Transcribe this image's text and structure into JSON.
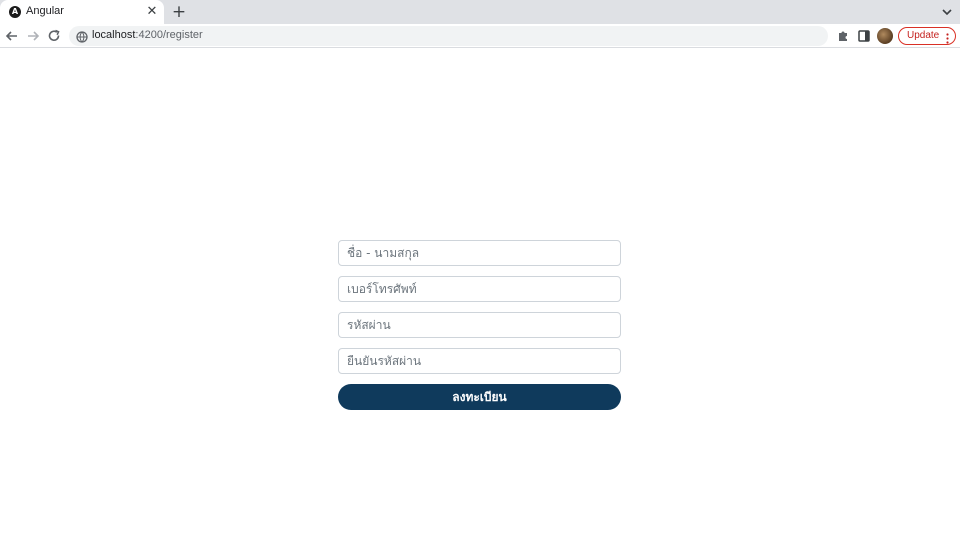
{
  "browser": {
    "tab": {
      "title": "Angular",
      "favicon": "angular-logo-icon",
      "close_glyph": "✕"
    },
    "new_tab_glyph": "+",
    "url": {
      "host": "localhost",
      "path": ":4200/register"
    },
    "update_label": "Update"
  },
  "form": {
    "fullname_placeholder": "ชื่อ - นามสกุล",
    "phone_placeholder": "เบอร์โทรศัพท์",
    "password_placeholder": "รหัสผ่าน",
    "confirm_password_placeholder": "ยืนยันรหัสผ่าน",
    "submit_label": "ลงทะเบียน"
  },
  "colors": {
    "submit_background": "#0f3a5c",
    "update_border": "#d93025"
  }
}
